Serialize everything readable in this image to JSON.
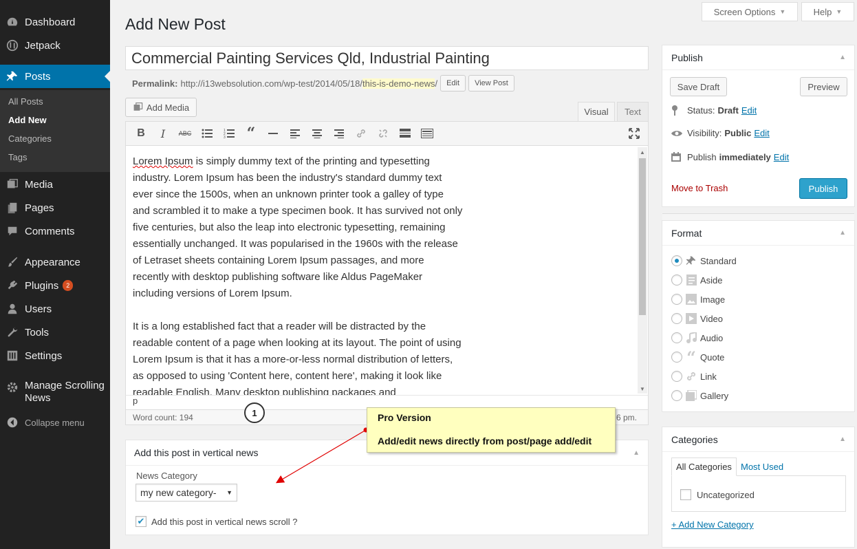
{
  "menu": {
    "items": [
      {
        "label": "Dashboard",
        "icon": "dashboard-icon"
      },
      {
        "label": "Jetpack",
        "icon": "jetpack-icon"
      },
      {
        "label": "Posts",
        "icon": "pin-icon"
      },
      {
        "label": "Media",
        "icon": "media-icon"
      },
      {
        "label": "Pages",
        "icon": "pages-icon"
      },
      {
        "label": "Comments",
        "icon": "comments-icon"
      },
      {
        "label": "Appearance",
        "icon": "brush-icon"
      },
      {
        "label": "Plugins",
        "icon": "plugin-icon",
        "badge": "2"
      },
      {
        "label": "Users",
        "icon": "users-icon"
      },
      {
        "label": "Tools",
        "icon": "wrench-icon"
      },
      {
        "label": "Settings",
        "icon": "settings-icon"
      },
      {
        "label": "Manage Scrolling News",
        "line1": "Manage Scrolling",
        "line2": "News",
        "icon": "gear-icon"
      }
    ],
    "posts_submenu": [
      "All Posts",
      "Add New",
      "Categories",
      "Tags"
    ],
    "collapse": "Collapse menu"
  },
  "screen_meta": {
    "screen_options": "Screen Options",
    "help": "Help"
  },
  "page_title": "Add New Post",
  "post_title": "Commercial Painting Services Qld, Industrial Painting",
  "permalink": {
    "label": "Permalink:",
    "base": "http://i13websolution.com/wp-test/2014/05/18/",
    "slug": "this-is-demo-news",
    "trail": "/",
    "edit": "Edit",
    "view": "View Post"
  },
  "editor": {
    "add_media": "Add Media",
    "tab_visual": "Visual",
    "tab_text": "Text",
    "paragraph1_first": "Lorem Ipsum",
    "paragraph1_rest": " is simply dummy text of the printing and typesetting industry. Lorem Ipsum has been the industry's standard dummy text ever since the 1500s, when an unknown printer took a galley of type and scrambled it to make a type specimen book. It has survived not only five centuries, but also the leap into electronic typesetting, remaining essentially unchanged. It was popularised in the 1960s with the release of Letraset sheets containing Lorem Ipsum passages, and more recently with desktop publishing software like Aldus PageMaker including versions of Lorem Ipsum.",
    "paragraph2": "It is a long established fact that a reader will be distracted by the readable content of a page when looking at its layout. The point of using Lorem Ipsum is that it has a more-or-less normal distribution of letters, as opposed to using 'Content here, content here', making it look like readable English. Many desktop publishing packages and",
    "path": "p",
    "word_count": "Word count: 194",
    "status_right": "6 pm."
  },
  "news_box": {
    "title": "Add this post in vertical news",
    "category_label": "News Category",
    "category_value": "my new category-",
    "checkbox_label": "Add this post in vertical news scroll ?"
  },
  "annotation": {
    "step": "1",
    "title": "Pro Version",
    "text": "Add/edit news directly from post/page add/edit"
  },
  "publish": {
    "title": "Publish",
    "save_draft": "Save Draft",
    "preview": "Preview",
    "status_label": "Status:",
    "status_value": "Draft",
    "visibility_label": "Visibility:",
    "visibility_value": "Public",
    "publish_label": "Publish",
    "publish_value": "immediately",
    "edit": "Edit",
    "trash": "Move to Trash",
    "publish_button": "Publish"
  },
  "format": {
    "title": "Format",
    "options": [
      "Standard",
      "Aside",
      "Image",
      "Video",
      "Audio",
      "Quote",
      "Link",
      "Gallery"
    ],
    "selected": "Standard"
  },
  "categories": {
    "title": "Categories",
    "tab_all": "All Categories",
    "tab_most": "Most Used",
    "items": [
      "Uncategorized"
    ],
    "add_new": "+ Add New Category"
  },
  "colors": {
    "menu_bg": "#222222",
    "accent": "#0073aa",
    "primary_button": "#2ea2cc",
    "callout_bg": "#ffffbf",
    "arrow": "#e00000"
  }
}
